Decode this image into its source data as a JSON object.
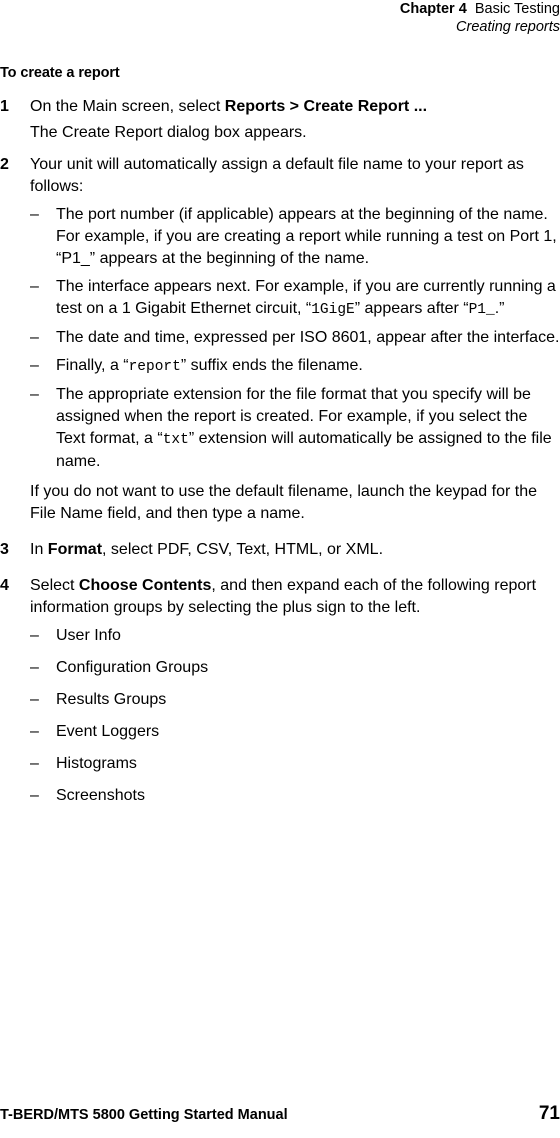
{
  "header": {
    "chapter_label": "Chapter 4",
    "chapter_title": "Basic Testing",
    "section_title": "Creating reports"
  },
  "section": {
    "heading": "To create a report"
  },
  "steps": [
    {
      "number": "1",
      "text_before_bold": "On the Main screen, select ",
      "bold_text": "Reports > Create Report ...",
      "text_after_bold": "",
      "follow_up": "The Create Report dialog box appears."
    },
    {
      "number": "2",
      "text_before_bold": "Your unit will automatically assign a default file name to your report as follows:",
      "bold_text": "",
      "text_after_bold": "",
      "bullets": [
        {
          "part1": "The port number (if applicable) appears at the beginning of the name. For example, if you are creating a report while running a test on Port 1, “P1_” appears at the beginning of the name.",
          "mono1": "",
          "part2": "",
          "mono2": "",
          "part3": ""
        },
        {
          "part1": "The interface appears next. For example, if you are currently running a test on a 1 Gigabit Ethernet circuit, “",
          "mono1": "1GigE",
          "part2": "” appears after “",
          "mono2": "P1_",
          "part3": ".”"
        },
        {
          "part1": "The date and time, expressed per ISO 8601, appear after the interface.",
          "mono1": "",
          "part2": "",
          "mono2": "",
          "part3": ""
        },
        {
          "part1": "Finally, a “",
          "mono1": "report",
          "part2": "” suffix ends the filename.",
          "mono2": "",
          "part3": ""
        },
        {
          "part1": "The appropriate extension for the file format that you specify will be assigned when the report is created. For example, if you select the Text format, a “",
          "mono1": "txt",
          "part2": "” extension will automatically be assigned to the file name.",
          "mono2": "",
          "part3": ""
        }
      ],
      "follow_up": "If you do not want to use the default filename, launch the keypad for the File Name field, and then type a name."
    },
    {
      "number": "3",
      "text_before_bold": "In ",
      "bold_text": "Format",
      "text_after_bold": ", select PDF, CSV, Text, HTML, or XML.",
      "follow_up": ""
    },
    {
      "number": "4",
      "text_before_bold": "Select ",
      "bold_text": "Choose Contents",
      "text_after_bold": ", and then expand each of the following report information groups by selecting the plus sign to the left.",
      "follow_up": "",
      "groups": [
        "User Info",
        "Configuration Groups",
        "Results Groups",
        "Event Loggers",
        "Histograms",
        "Screenshots"
      ]
    }
  ],
  "bullet_mark": "–",
  "footer": {
    "manual_title": "T-BERD/MTS 5800 Getting Started Manual",
    "page_number": "71"
  },
  "colors": {
    "text": "#000000",
    "background": "#ffffff"
  }
}
